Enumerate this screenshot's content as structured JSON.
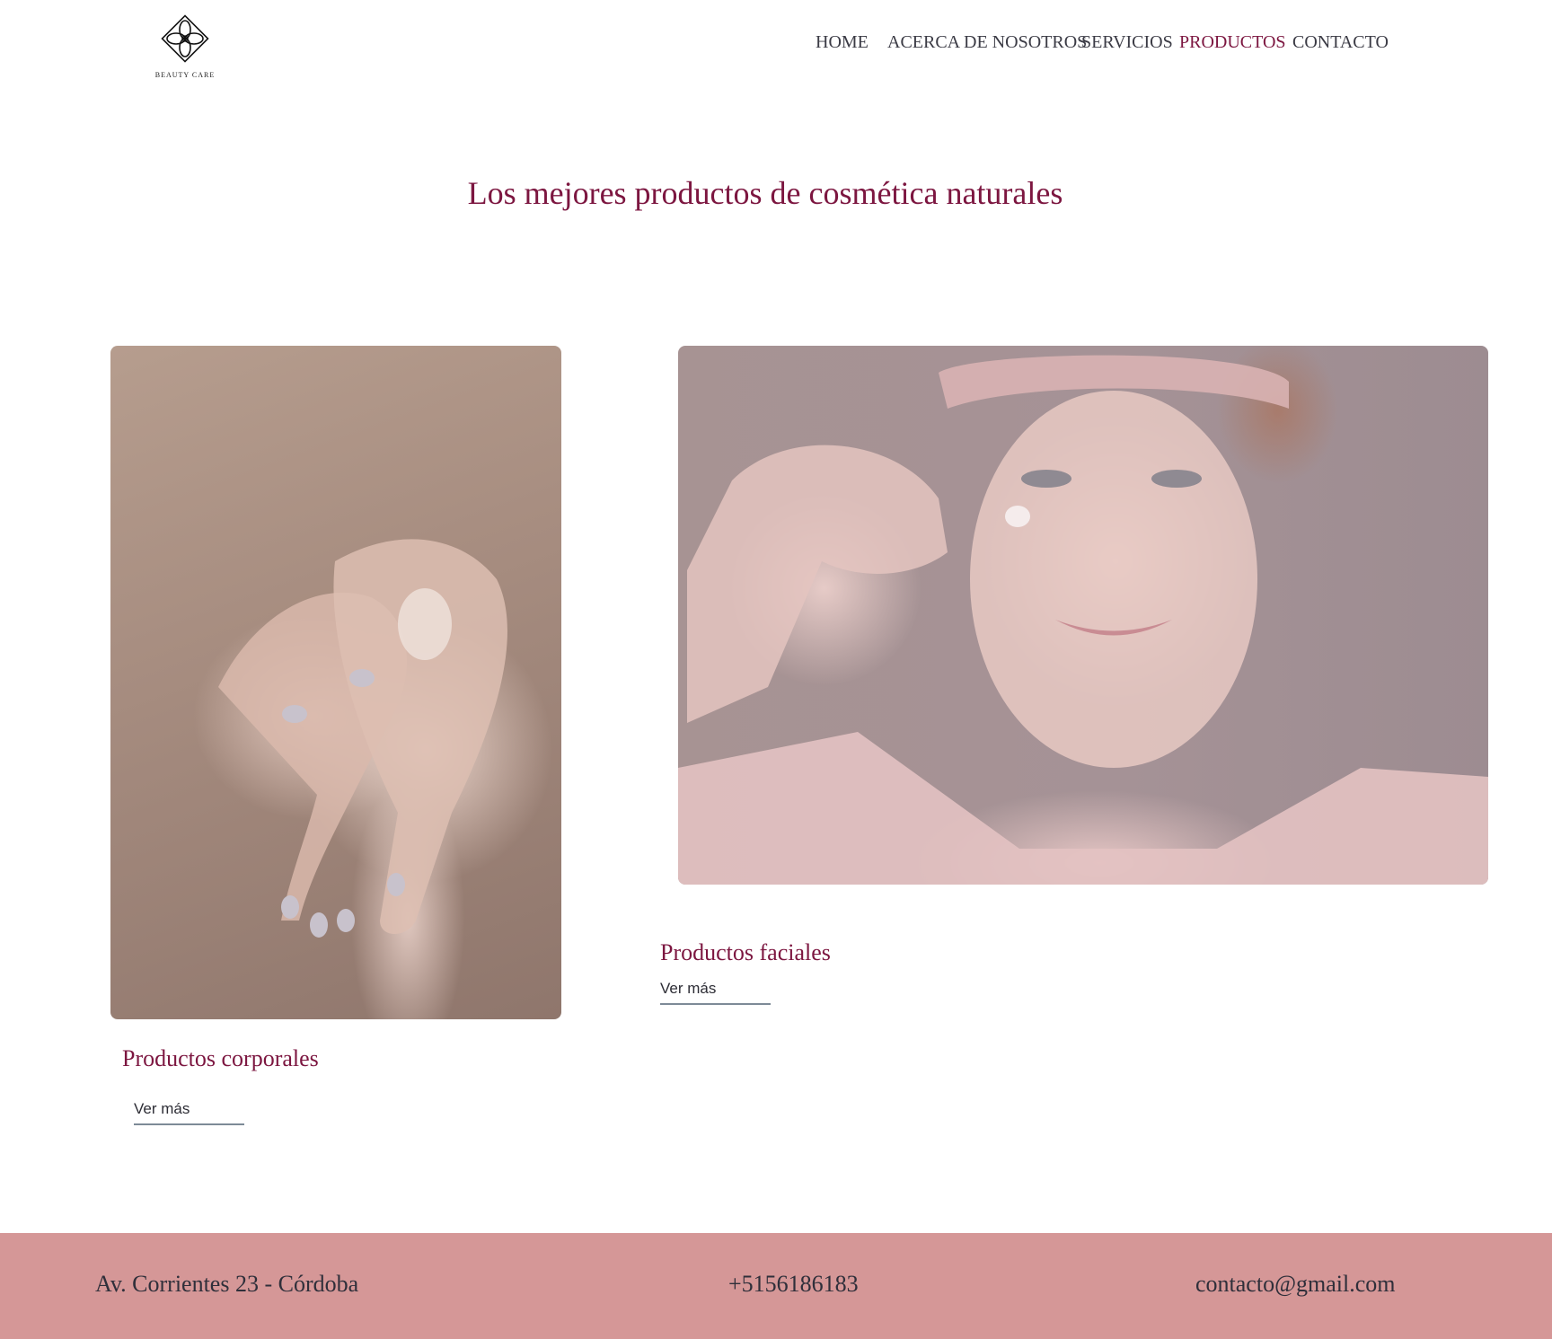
{
  "header": {
    "logo_text": "BEAUTY CARE",
    "nav": [
      {
        "label": "HOME",
        "active": false
      },
      {
        "label": "ACERCA DE NOSOTROS",
        "active": false
      },
      {
        "label": "SERVICIOS",
        "active": false
      },
      {
        "label": "PRODUCTOS",
        "active": true
      },
      {
        "label": "CONTACTO",
        "active": false
      }
    ]
  },
  "main": {
    "title": "Los mejores productos de cosmética naturales",
    "products": [
      {
        "title": "Productos corporales",
        "link": "Ver más"
      },
      {
        "title": "Productos faciales",
        "link": "Ver más"
      }
    ]
  },
  "footer": {
    "address": "Av. Corrientes 23 - Córdoba",
    "phone": "+5156186183",
    "email": "contacto@gmail.com"
  },
  "colors": {
    "accent": "#7c1640",
    "footer_bg": "#d59797",
    "text": "#2d2d35",
    "link_underline": "#7d8a97"
  }
}
